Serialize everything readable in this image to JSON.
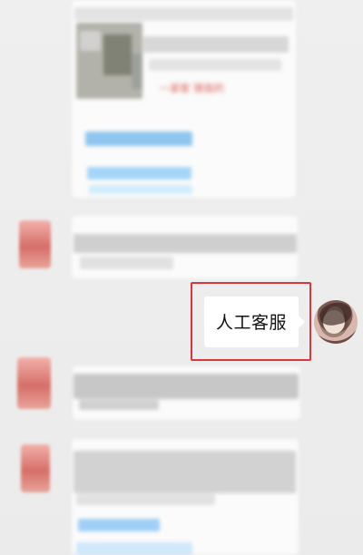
{
  "chat": {
    "highlighted_message": "人工客服",
    "blurred_caption": "一家客 猜我的"
  },
  "colors": {
    "highlight_border": "#d9363e",
    "message_bubble": "#ffffff",
    "page_background": "#ececec",
    "avatar_red": "#d56f68",
    "blurred_blue": "#8fc6f0"
  },
  "icons": {
    "user_avatar": "user-avatar",
    "service_avatar": "service-avatar"
  }
}
